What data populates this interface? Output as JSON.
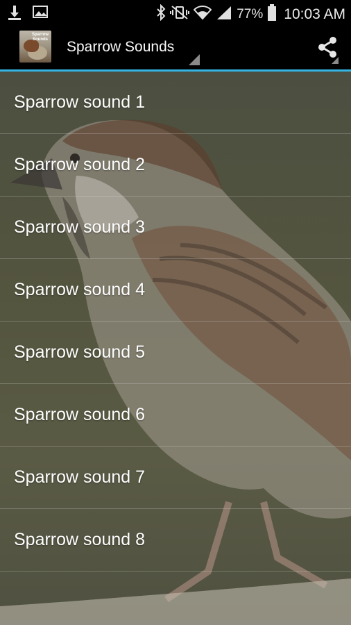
{
  "status_bar": {
    "battery": "77%",
    "time": "10:03 AM"
  },
  "action_bar": {
    "icon_text": "Sparrow Sounds",
    "title": "Sparrow Sounds"
  },
  "list": {
    "items": [
      {
        "label": "Sparrow sound 1"
      },
      {
        "label": "Sparrow sound 2"
      },
      {
        "label": "Sparrow sound 3"
      },
      {
        "label": "Sparrow sound 4"
      },
      {
        "label": "Sparrow sound 5"
      },
      {
        "label": "Sparrow sound 6"
      },
      {
        "label": "Sparrow sound 7"
      },
      {
        "label": "Sparrow sound 8"
      }
    ]
  },
  "colors": {
    "accent": "#33b5e5",
    "background": "#54553f"
  }
}
